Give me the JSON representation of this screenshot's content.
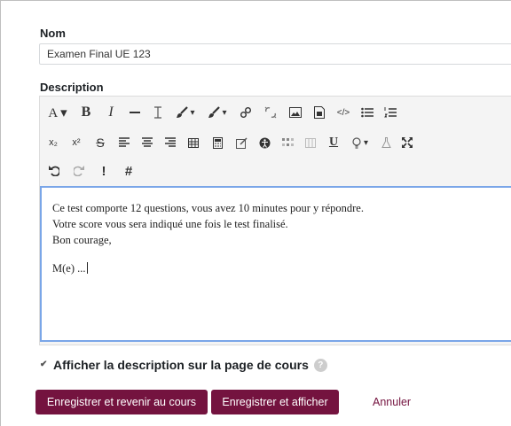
{
  "form": {
    "name_label": "Nom",
    "name_value": "Examen Final UE 123",
    "description_label": "Description"
  },
  "toolbar": {
    "row1": [
      {
        "name": "font-size-dropdown",
        "label": "A ▾",
        "icon": "text-style"
      },
      {
        "name": "bold-button",
        "label": "B",
        "icon": "bold"
      },
      {
        "name": "italic-button",
        "label": "I",
        "icon": "italic"
      },
      {
        "name": "horizontal-rule-button",
        "label": "",
        "icon": "horizontal-rule"
      },
      {
        "name": "clear-formatting-button",
        "label": "",
        "icon": "text-cursor"
      },
      {
        "name": "text-color-dropdown",
        "label": "▾",
        "icon": "brush"
      },
      {
        "name": "background-color-dropdown",
        "label": "▾",
        "icon": "brush"
      },
      {
        "name": "link-button",
        "label": "",
        "icon": "link"
      },
      {
        "name": "unlink-button",
        "label": "",
        "icon": "unlink"
      },
      {
        "name": "image-button",
        "label": "",
        "icon": "image"
      },
      {
        "name": "media-button",
        "label": "",
        "icon": "media"
      },
      {
        "name": "html-button",
        "label": "</>",
        "icon": "code"
      },
      {
        "name": "unordered-list-button",
        "label": "",
        "icon": "unordered-list"
      },
      {
        "name": "ordered-list-button",
        "label": "",
        "icon": "ordered-list"
      }
    ],
    "row2": [
      {
        "name": "subscript-button",
        "label": "x₂",
        "icon": "subscript"
      },
      {
        "name": "superscript-button",
        "label": "x²",
        "icon": "superscript"
      },
      {
        "name": "strikethrough-button",
        "label": "S",
        "icon": "strikethrough"
      },
      {
        "name": "align-left-button",
        "label": "",
        "icon": "align-left"
      },
      {
        "name": "align-center-button",
        "label": "",
        "icon": "align-center"
      },
      {
        "name": "align-right-button",
        "label": "",
        "icon": "align-right"
      },
      {
        "name": "table-button",
        "label": "",
        "icon": "table"
      },
      {
        "name": "equation-button",
        "label": "",
        "icon": "calculator"
      },
      {
        "name": "edit-button",
        "label": "",
        "icon": "edit"
      },
      {
        "name": "accessibility-button",
        "label": "",
        "icon": "accessibility"
      },
      {
        "name": "special-char-button",
        "label": "",
        "icon": "grid"
      },
      {
        "name": "columns-button",
        "label": "",
        "icon": "columns"
      },
      {
        "name": "underline-button",
        "label": "U",
        "icon": "underline"
      },
      {
        "name": "hint-dropdown",
        "label": "▾",
        "icon": "lightbulb"
      },
      {
        "name": "lab-button",
        "label": "",
        "icon": "flask"
      },
      {
        "name": "fullscreen-button",
        "label": "",
        "icon": "expand"
      }
    ],
    "row3": [
      {
        "name": "undo-button",
        "label": "",
        "icon": "undo"
      },
      {
        "name": "redo-button",
        "label": "",
        "icon": "redo"
      },
      {
        "name": "important-button",
        "label": "!",
        "icon": "exclamation"
      },
      {
        "name": "hashtag-button",
        "label": "#",
        "icon": "hash"
      }
    ]
  },
  "editor": {
    "line1": "Ce test comporte 12 questions, vous avez 10 minutes pour y répondre.",
    "line2": "Votre score vous sera indiqué une fois le test finalisé.",
    "line3": "Bon courage,",
    "line4": "M(e) ..."
  },
  "options": {
    "show_description_label": "Afficher la description sur la page de cours",
    "show_description_checked": true,
    "help_label": "?"
  },
  "actions": {
    "save_return_label": "Enregistrer et revenir au cours",
    "save_display_label": "Enregistrer et afficher",
    "cancel_label": "Annuler"
  },
  "colors": {
    "primary_button": "#74133f",
    "editor_focus_border": "#7aa6e8"
  }
}
